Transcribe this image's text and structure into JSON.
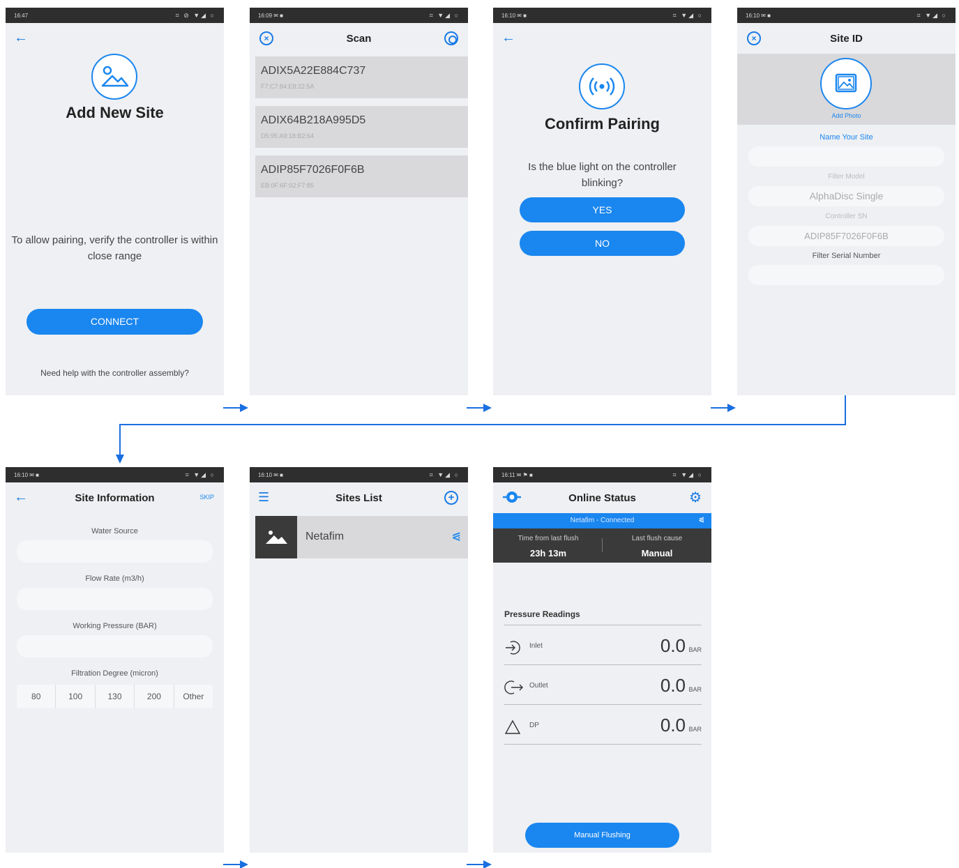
{
  "screen1": {
    "time": "16:47",
    "status_right": "⌗ ⊘ ▼◢ ○",
    "title": "Add New Site",
    "message": "To allow pairing, verify the controller is within close range",
    "connect_label": "CONNECT",
    "help_text": "Need help with the controller assembly?"
  },
  "screen2": {
    "time": "16:09 ✉ ■",
    "status_right": "⌗ ▼◢ ○",
    "title": "Scan",
    "devices": [
      {
        "name": "ADIX5A22E884C737",
        "mac": "F7:C7:84:E8:22:5A"
      },
      {
        "name": "ADIX64B218A995D5",
        "mac": "D5:95:A9:18:B2:64"
      },
      {
        "name": "ADIP85F7026F0F6B",
        "mac": "EB:0F:6F:02:F7:85"
      }
    ]
  },
  "screen3": {
    "time": "16:10 ✉ ■",
    "status_right": "⌗ ▼◢ ○",
    "title": "Confirm Pairing",
    "question": "Is the blue light on the controller blinking?",
    "yes_label": "YES",
    "no_label": "NO"
  },
  "screen4": {
    "time": "16:10 ✉ ■",
    "status_right": "⌗ ▼◢ ○",
    "title": "Site ID",
    "add_photo": "Add Photo",
    "name_label": "Name Your Site",
    "filter_model_label": "Filter Model",
    "filter_model_value": "AlphaDisc Single",
    "controller_sn_label": "Controller SN",
    "controller_sn_value": "ADIP85F7026F0F6B",
    "filter_serial_label": "Filter Serial Number"
  },
  "screen5": {
    "time": "16:10 ✉ ■",
    "status_right": "⌗ ▼◢ ○",
    "title": "Site Information",
    "skip": "SKIP",
    "water_source_label": "Water Source",
    "flow_rate_label": "Flow Rate (m3/h)",
    "working_pressure_label": "Working Pressure (BAR)",
    "filtration_label": "Filtration Degree (micron)",
    "filtration_options": [
      "80",
      "100",
      "130",
      "200",
      "Other"
    ]
  },
  "screen6": {
    "time": "16:10 ✉ ■",
    "status_right": "⌗ ▼◢ ○",
    "title": "Sites List",
    "site_name": "Netafim"
  },
  "screen7": {
    "time": "16:11 ✉ ⚑ ■",
    "status_right": "⌗ ▼◢ ○",
    "title": "Online Status",
    "connection_banner": "Netafim - Connected",
    "time_from_last_flush_label": "Time from last flush",
    "time_from_last_flush_value": "23h 13m",
    "last_flush_cause_label": "Last flush cause",
    "last_flush_cause_value": "Manual",
    "pressure_heading": "Pressure Readings",
    "readings": [
      {
        "label": "Inlet",
        "value": "0.0",
        "unit": "BAR"
      },
      {
        "label": "Outlet",
        "value": "0.0",
        "unit": "BAR"
      },
      {
        "label": "DP",
        "value": "0.0",
        "unit": "BAR"
      }
    ],
    "manual_flushing_label": "Manual Flushing"
  },
  "colors": {
    "accent": "#1a86ef",
    "status_bar": "#2e2e2e",
    "screen_bg": "#eef0f3",
    "flow_arrow": "#1a6fe0"
  }
}
